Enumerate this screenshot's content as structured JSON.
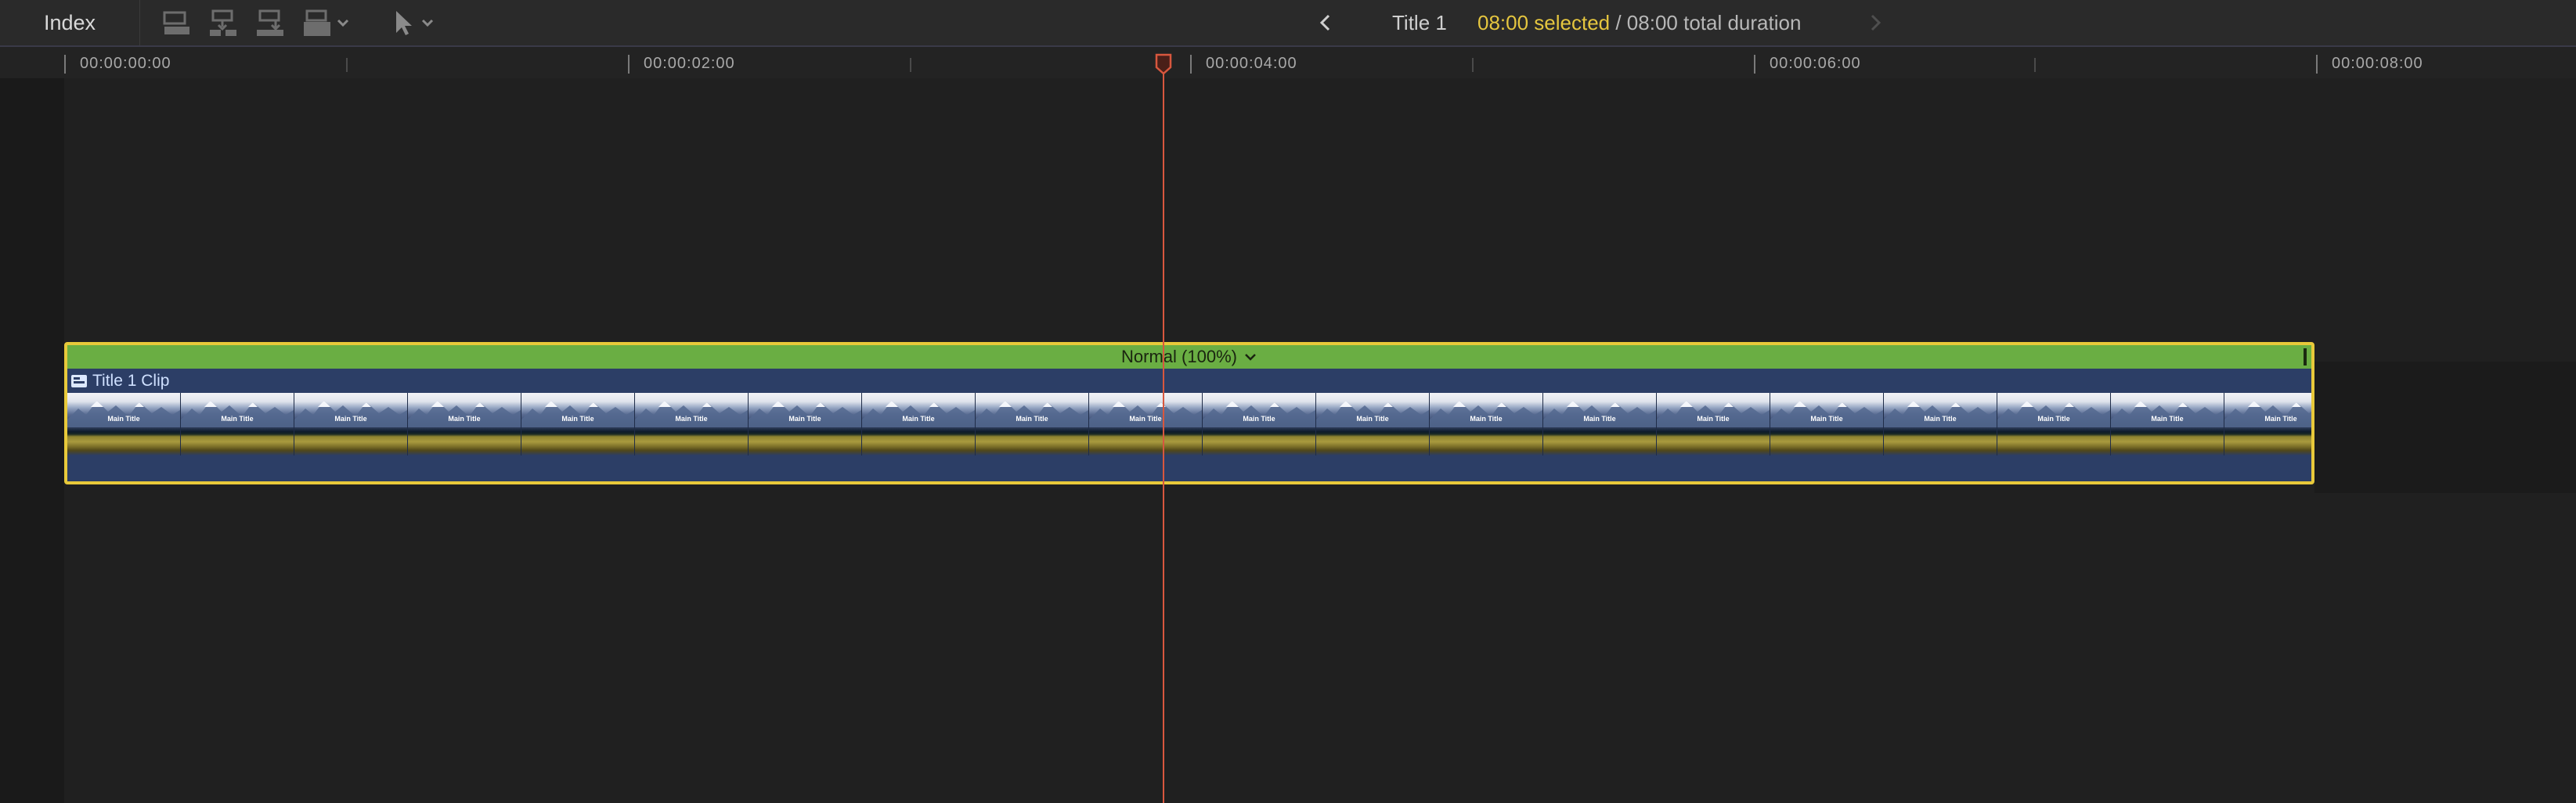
{
  "toolbar": {
    "index_label": "Index",
    "icons": [
      "append-clip-icon",
      "insert-clip-icon",
      "connect-clip-icon",
      "overwrite-clip-icon",
      "select-tool-icon"
    ]
  },
  "navigation": {
    "project_title": "Title 1",
    "selected_text": "08:00 selected",
    "total_text": " / 08:00 total duration"
  },
  "ruler": {
    "labels": [
      "00:00:00:00",
      "00:00:02:00",
      "00:00:04:00",
      "00:00:06:00",
      "00:00:08:00"
    ]
  },
  "clip": {
    "speed_label": "Normal (100%)",
    "name": "Title 1 Clip",
    "frame_caption": "Main Title",
    "header_color": "#6aae43",
    "selection_color": "#e8c93a",
    "body_color": "#2c3e66"
  },
  "playhead": {
    "color": "#d8573e"
  }
}
